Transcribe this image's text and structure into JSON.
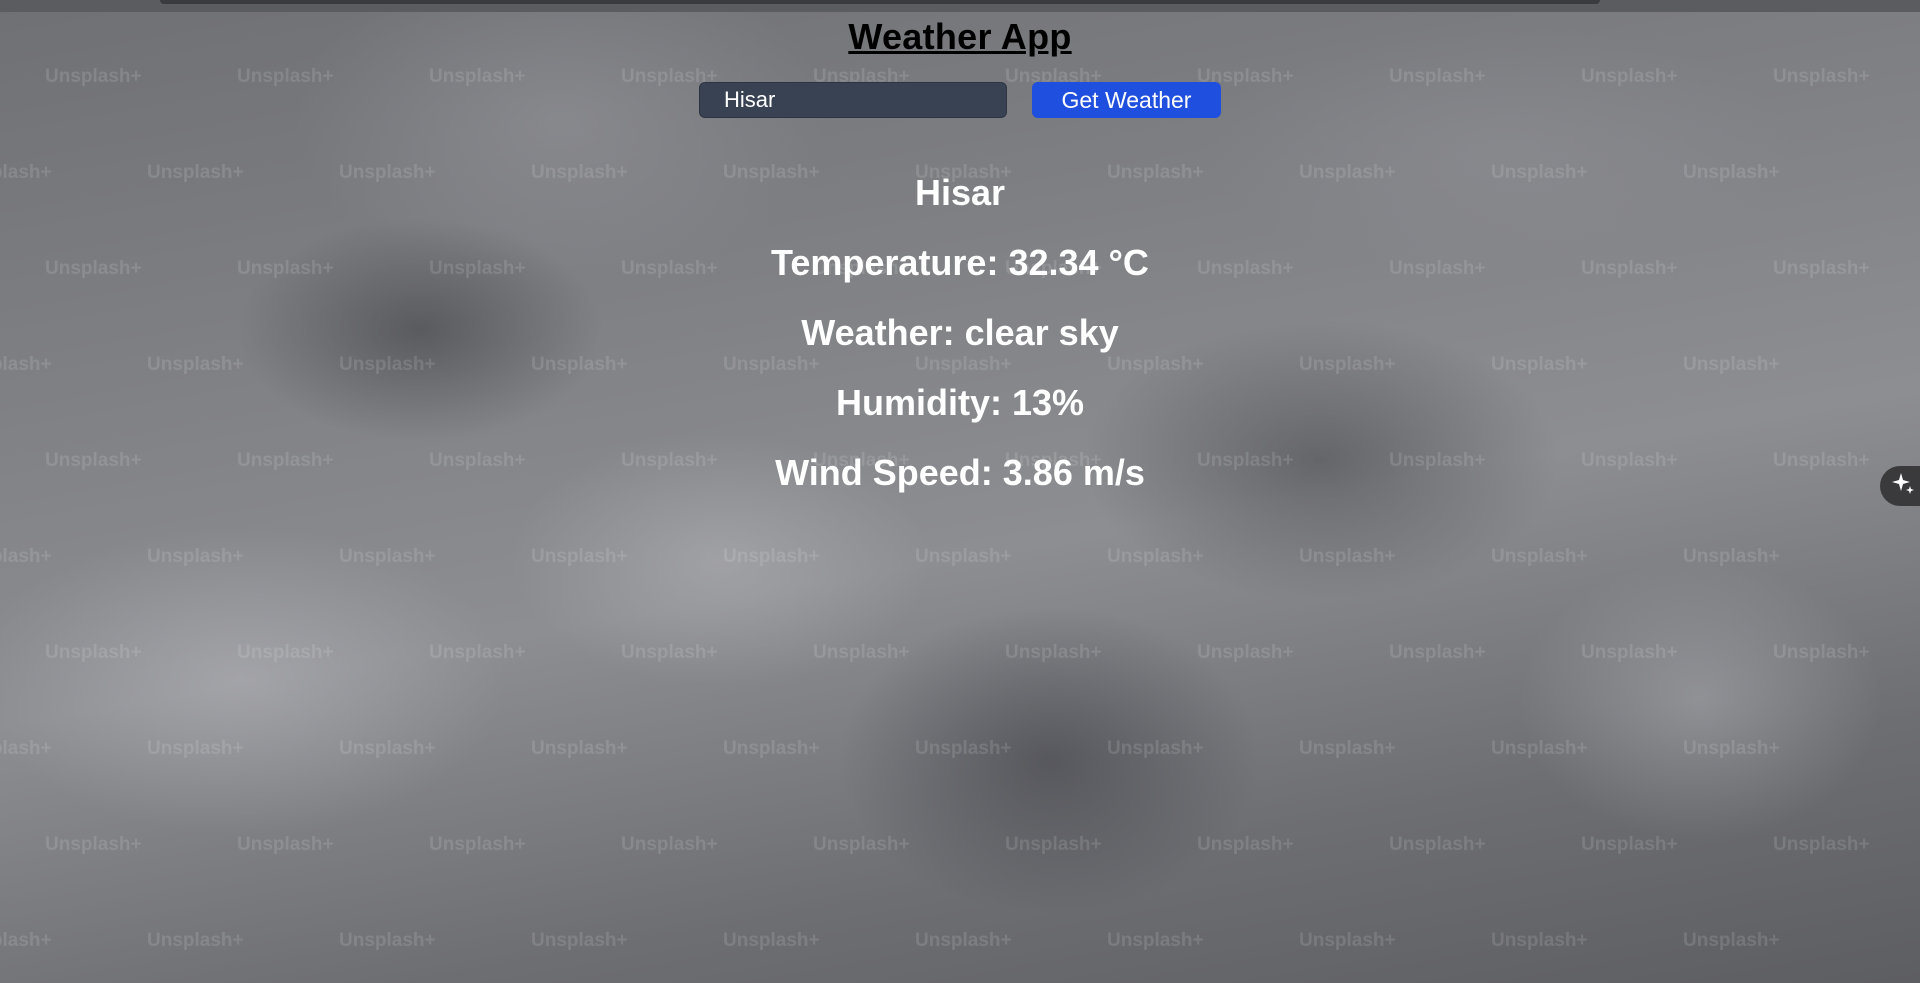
{
  "app": {
    "title": "Weather App"
  },
  "search": {
    "value": "Hisar",
    "button_label": "Get Weather"
  },
  "weather": {
    "city": "Hisar",
    "temperature": "Temperature: 32.34 °C",
    "description": "Weather: clear sky",
    "humidity": "Humidity: 13%",
    "wind_speed": "Wind Speed: 3.86 m/s"
  },
  "background": {
    "watermark_text": "Unsplash+"
  },
  "icons": {
    "side_fab": "sparkle-icon"
  },
  "colors": {
    "button_bg": "#1e4fde",
    "input_bg": "#394253",
    "text_light": "#ffffff",
    "title_text": "#000000"
  }
}
